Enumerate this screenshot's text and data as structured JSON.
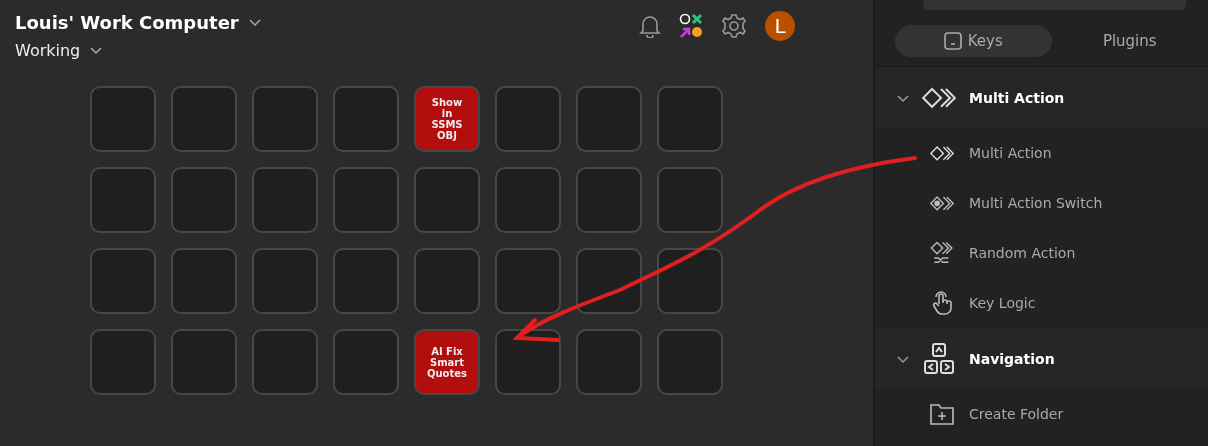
{
  "header": {
    "title": "Louis' Work Computer",
    "profile": "Working",
    "avatar": "L"
  },
  "keys": [
    {
      "kind": "empty"
    },
    {
      "kind": "empty"
    },
    {
      "kind": "empty"
    },
    {
      "kind": "empty"
    },
    {
      "kind": "action",
      "label": "Show in SSMS OBJ"
    },
    {
      "kind": "empty"
    },
    {
      "kind": "empty"
    },
    {
      "kind": "empty"
    },
    {
      "kind": "empty"
    },
    {
      "kind": "empty"
    },
    {
      "kind": "empty"
    },
    {
      "kind": "empty"
    },
    {
      "kind": "empty"
    },
    {
      "kind": "empty"
    },
    {
      "kind": "empty"
    },
    {
      "kind": "empty"
    },
    {
      "kind": "empty"
    },
    {
      "kind": "empty"
    },
    {
      "kind": "empty"
    },
    {
      "kind": "empty"
    },
    {
      "kind": "empty"
    },
    {
      "kind": "empty"
    },
    {
      "kind": "empty"
    },
    {
      "kind": "empty"
    },
    {
      "kind": "empty"
    },
    {
      "kind": "empty"
    },
    {
      "kind": "empty"
    },
    {
      "kind": "empty"
    },
    {
      "kind": "action",
      "label": "AI Fix Smart Quotes"
    },
    {
      "kind": "empty"
    },
    {
      "kind": "empty"
    },
    {
      "kind": "empty"
    }
  ],
  "sidebar": {
    "tabs": [
      {
        "label": "Keys",
        "selected": true
      },
      {
        "label": "Plugins",
        "selected": false
      }
    ],
    "sections": [
      {
        "title": "Multi Action",
        "kind": "multi",
        "expanded": true,
        "items": [
          {
            "label": "Multi Action",
            "kind": "multi"
          },
          {
            "label": "Multi Action Switch",
            "kind": "switch"
          },
          {
            "label": "Random Action",
            "kind": "random"
          },
          {
            "label": "Key Logic",
            "kind": "hand"
          }
        ]
      },
      {
        "title": "Navigation",
        "kind": "nav",
        "expanded": true,
        "items": [
          {
            "label": "Create Folder",
            "kind": "folder"
          }
        ]
      }
    ]
  }
}
